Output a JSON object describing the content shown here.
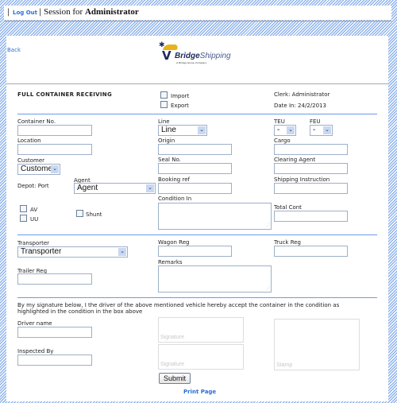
{
  "topbar": {
    "logout": "Log Out",
    "session_prefix": "Session for",
    "user": "Administrator"
  },
  "nav": {
    "back": "Back"
  },
  "logo": {
    "brand1": "Bridge",
    "brand2": "Shipping",
    "tagline": "A Bridge Group Company",
    "colors": {
      "yellow": "#e8b21c",
      "navy": "#1d2a5c"
    }
  },
  "header": {
    "title": "FULL CONTAINER RECEIVING",
    "import": "Import",
    "export": "Export",
    "clerk": "Clerk: Administrator",
    "date_in": "Date In: 24/2/2013"
  },
  "fields": {
    "container_no": "Container No.",
    "line": "Line",
    "line_value": "Line",
    "teu": "TEU",
    "teu_value": "-",
    "feu": "FEU",
    "feu_value": "-",
    "location": "Location",
    "origin": "Origin",
    "cargo": "Cargo",
    "customer": "Customer",
    "customer_value": "Customer",
    "seal_no": "Seal No.",
    "clearing_agent": "Clearing Agent",
    "depot": "Depot: Port",
    "agent": "Agent",
    "agent_value": "Agent",
    "booking_ref": "Booking ref",
    "shipping_instruction": "Shipping Instruction",
    "condition_in": "Condition In",
    "total_cont": "Total Cont",
    "av": "AV",
    "uu": "UU",
    "shunt": "Shunt",
    "transporter": "Transporter",
    "transporter_value": "Transporter",
    "wagon_reg": "Wagon Reg",
    "truck_reg": "Truck Reg",
    "remarks": "Remarks",
    "trailer_reg": "Trailer Reg"
  },
  "signature": {
    "statement": "By my signature below, I the driver of the above mentioned vehicle hereby accept the container in the condition as highlighted in the condition in the box above",
    "driver_name": "Driver name",
    "inspected_by": "Inspected By",
    "sig1": "Signature",
    "sig2": "Signature",
    "stamp": "Stamp"
  },
  "actions": {
    "submit": "Submit",
    "print": "Print Page"
  }
}
